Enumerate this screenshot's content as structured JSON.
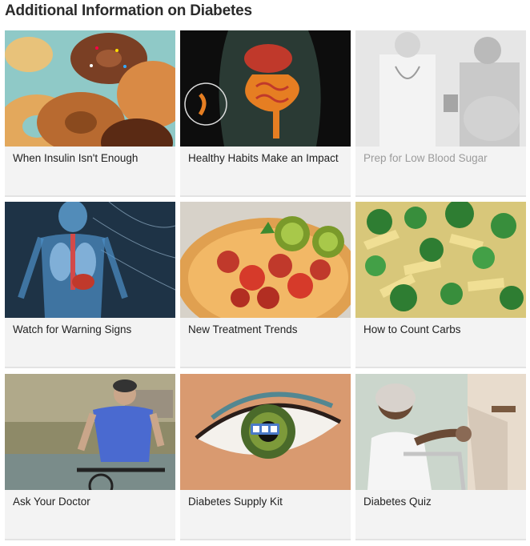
{
  "title": "Additional Information on Diabetes",
  "cards": [
    {
      "label": "When Insulin Isn't Enough",
      "image": "donuts-photo"
    },
    {
      "label": "Healthy Habits Make an Impact",
      "image": "digestive-system-illustration"
    },
    {
      "label": "Prep for Low Blood Sugar",
      "image": "doctor-with-pregnant-patient-photo"
    },
    {
      "label": "Watch for Warning Signs",
      "image": "x-ray-body-illustration"
    },
    {
      "label": "New Treatment Trends",
      "image": "fruit-bowl-photo"
    },
    {
      "label": "How to Count Carbs",
      "image": "pasta-with-broccoli-photo"
    },
    {
      "label": "Ask Your Doctor",
      "image": "man-on-bicycle-photo"
    },
    {
      "label": "Diabetes Supply Kit",
      "image": "eye-closeup-photo"
    },
    {
      "label": "Diabetes Quiz",
      "image": "woman-with-caregiver-photo"
    }
  ],
  "colors": {
    "card_bg": "#f3f3f3",
    "title_text": "#2b2b2b",
    "label_text": "#222222",
    "dimmed_label_text": "#9b9b9b"
  }
}
